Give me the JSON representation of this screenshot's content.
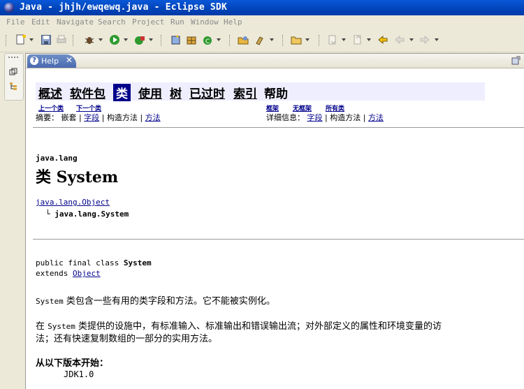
{
  "window": {
    "title": "Java - jhjh/ewqewq.java - Eclipse SDK"
  },
  "menubar": [
    "File",
    "Edit",
    "Navigate",
    "Search",
    "Project",
    "Run",
    "Window",
    "Help"
  ],
  "view": {
    "tab_label": "Help",
    "tab_close": "✕"
  },
  "doc": {
    "nav": {
      "overview": "概述",
      "package": "软件包",
      "class": "类",
      "use": "使用",
      "tree": "树",
      "deprecated": "已过时",
      "index": "索引",
      "help": "帮助"
    },
    "nav_prev": "上一个类",
    "nav_next": "下一个类",
    "nav_frames": "框架",
    "nav_noframes": "无框架",
    "nav_allclasses": "所有类",
    "summary_label": "摘要：",
    "summary_nested": "嵌套",
    "summary_field": "字段",
    "summary_constr": "构造方法",
    "summary_method": "方法",
    "detail_label": "详细信息：",
    "detail_field": "字段",
    "detail_constr": "构造方法",
    "detail_method": "方法",
    "sep": "|",
    "package_name": "java.lang",
    "class_title": "类 System",
    "tree_parent": "java.lang.Object",
    "tree_branch": "└",
    "tree_child": "java.lang.System",
    "decl_line1_prefix": "public final class ",
    "decl_line1_name": "System",
    "decl_line2_prefix": "extends ",
    "decl_line2_link": "Object",
    "desc1_code": "System",
    "desc1_text": " 类包含一些有用的类字段和方法。它不能被实例化。",
    "desc2_prefix": "在 ",
    "desc2_code": "System",
    "desc2_text": " 类提供的设施中，有标准输入、标准输出和错误输出流；对外部定义的属性和环境变量的访",
    "desc2_line2": "法；还有快速复制数组的一部分的实用方法。",
    "since_heading": "从以下版本开始：",
    "since_value": "JDK1.0"
  }
}
